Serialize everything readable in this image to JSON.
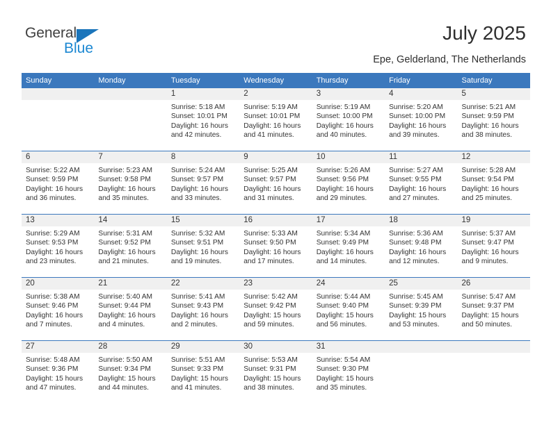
{
  "brand": {
    "name_part1": "General",
    "name_part2": "Blue",
    "triangle_icon": "triangle-icon",
    "colors": {
      "dark": "#3f3f3f",
      "blue": "#1b87d2",
      "triangle": "#1b75bb"
    }
  },
  "header": {
    "title": "July 2025",
    "subtitle": "Epe, Gelderland, The Netherlands"
  },
  "calendar": {
    "accent_color": "#3b78bd",
    "daynum_band_color": "#f0f0f0",
    "weekday_headers": [
      "Sunday",
      "Monday",
      "Tuesday",
      "Wednesday",
      "Thursday",
      "Friday",
      "Saturday"
    ],
    "weeks": [
      [
        {
          "day": "",
          "sunrise": "",
          "sunset": "",
          "daylight": ""
        },
        {
          "day": "",
          "sunrise": "",
          "sunset": "",
          "daylight": ""
        },
        {
          "day": "1",
          "sunrise": "Sunrise: 5:18 AM",
          "sunset": "Sunset: 10:01 PM",
          "daylight": "Daylight: 16 hours and 42 minutes."
        },
        {
          "day": "2",
          "sunrise": "Sunrise: 5:19 AM",
          "sunset": "Sunset: 10:01 PM",
          "daylight": "Daylight: 16 hours and 41 minutes."
        },
        {
          "day": "3",
          "sunrise": "Sunrise: 5:19 AM",
          "sunset": "Sunset: 10:00 PM",
          "daylight": "Daylight: 16 hours and 40 minutes."
        },
        {
          "day": "4",
          "sunrise": "Sunrise: 5:20 AM",
          "sunset": "Sunset: 10:00 PM",
          "daylight": "Daylight: 16 hours and 39 minutes."
        },
        {
          "day": "5",
          "sunrise": "Sunrise: 5:21 AM",
          "sunset": "Sunset: 9:59 PM",
          "daylight": "Daylight: 16 hours and 38 minutes."
        }
      ],
      [
        {
          "day": "6",
          "sunrise": "Sunrise: 5:22 AM",
          "sunset": "Sunset: 9:59 PM",
          "daylight": "Daylight: 16 hours and 36 minutes."
        },
        {
          "day": "7",
          "sunrise": "Sunrise: 5:23 AM",
          "sunset": "Sunset: 9:58 PM",
          "daylight": "Daylight: 16 hours and 35 minutes."
        },
        {
          "day": "8",
          "sunrise": "Sunrise: 5:24 AM",
          "sunset": "Sunset: 9:57 PM",
          "daylight": "Daylight: 16 hours and 33 minutes."
        },
        {
          "day": "9",
          "sunrise": "Sunrise: 5:25 AM",
          "sunset": "Sunset: 9:57 PM",
          "daylight": "Daylight: 16 hours and 31 minutes."
        },
        {
          "day": "10",
          "sunrise": "Sunrise: 5:26 AM",
          "sunset": "Sunset: 9:56 PM",
          "daylight": "Daylight: 16 hours and 29 minutes."
        },
        {
          "day": "11",
          "sunrise": "Sunrise: 5:27 AM",
          "sunset": "Sunset: 9:55 PM",
          "daylight": "Daylight: 16 hours and 27 minutes."
        },
        {
          "day": "12",
          "sunrise": "Sunrise: 5:28 AM",
          "sunset": "Sunset: 9:54 PM",
          "daylight": "Daylight: 16 hours and 25 minutes."
        }
      ],
      [
        {
          "day": "13",
          "sunrise": "Sunrise: 5:29 AM",
          "sunset": "Sunset: 9:53 PM",
          "daylight": "Daylight: 16 hours and 23 minutes."
        },
        {
          "day": "14",
          "sunrise": "Sunrise: 5:31 AM",
          "sunset": "Sunset: 9:52 PM",
          "daylight": "Daylight: 16 hours and 21 minutes."
        },
        {
          "day": "15",
          "sunrise": "Sunrise: 5:32 AM",
          "sunset": "Sunset: 9:51 PM",
          "daylight": "Daylight: 16 hours and 19 minutes."
        },
        {
          "day": "16",
          "sunrise": "Sunrise: 5:33 AM",
          "sunset": "Sunset: 9:50 PM",
          "daylight": "Daylight: 16 hours and 17 minutes."
        },
        {
          "day": "17",
          "sunrise": "Sunrise: 5:34 AM",
          "sunset": "Sunset: 9:49 PM",
          "daylight": "Daylight: 16 hours and 14 minutes."
        },
        {
          "day": "18",
          "sunrise": "Sunrise: 5:36 AM",
          "sunset": "Sunset: 9:48 PM",
          "daylight": "Daylight: 16 hours and 12 minutes."
        },
        {
          "day": "19",
          "sunrise": "Sunrise: 5:37 AM",
          "sunset": "Sunset: 9:47 PM",
          "daylight": "Daylight: 16 hours and 9 minutes."
        }
      ],
      [
        {
          "day": "20",
          "sunrise": "Sunrise: 5:38 AM",
          "sunset": "Sunset: 9:46 PM",
          "daylight": "Daylight: 16 hours and 7 minutes."
        },
        {
          "day": "21",
          "sunrise": "Sunrise: 5:40 AM",
          "sunset": "Sunset: 9:44 PM",
          "daylight": "Daylight: 16 hours and 4 minutes."
        },
        {
          "day": "22",
          "sunrise": "Sunrise: 5:41 AM",
          "sunset": "Sunset: 9:43 PM",
          "daylight": "Daylight: 16 hours and 2 minutes."
        },
        {
          "day": "23",
          "sunrise": "Sunrise: 5:42 AM",
          "sunset": "Sunset: 9:42 PM",
          "daylight": "Daylight: 15 hours and 59 minutes."
        },
        {
          "day": "24",
          "sunrise": "Sunrise: 5:44 AM",
          "sunset": "Sunset: 9:40 PM",
          "daylight": "Daylight: 15 hours and 56 minutes."
        },
        {
          "day": "25",
          "sunrise": "Sunrise: 5:45 AM",
          "sunset": "Sunset: 9:39 PM",
          "daylight": "Daylight: 15 hours and 53 minutes."
        },
        {
          "day": "26",
          "sunrise": "Sunrise: 5:47 AM",
          "sunset": "Sunset: 9:37 PM",
          "daylight": "Daylight: 15 hours and 50 minutes."
        }
      ],
      [
        {
          "day": "27",
          "sunrise": "Sunrise: 5:48 AM",
          "sunset": "Sunset: 9:36 PM",
          "daylight": "Daylight: 15 hours and 47 minutes."
        },
        {
          "day": "28",
          "sunrise": "Sunrise: 5:50 AM",
          "sunset": "Sunset: 9:34 PM",
          "daylight": "Daylight: 15 hours and 44 minutes."
        },
        {
          "day": "29",
          "sunrise": "Sunrise: 5:51 AM",
          "sunset": "Sunset: 9:33 PM",
          "daylight": "Daylight: 15 hours and 41 minutes."
        },
        {
          "day": "30",
          "sunrise": "Sunrise: 5:53 AM",
          "sunset": "Sunset: 9:31 PM",
          "daylight": "Daylight: 15 hours and 38 minutes."
        },
        {
          "day": "31",
          "sunrise": "Sunrise: 5:54 AM",
          "sunset": "Sunset: 9:30 PM",
          "daylight": "Daylight: 15 hours and 35 minutes."
        },
        {
          "day": "",
          "sunrise": "",
          "sunset": "",
          "daylight": ""
        },
        {
          "day": "",
          "sunrise": "",
          "sunset": "",
          "daylight": ""
        }
      ]
    ]
  }
}
